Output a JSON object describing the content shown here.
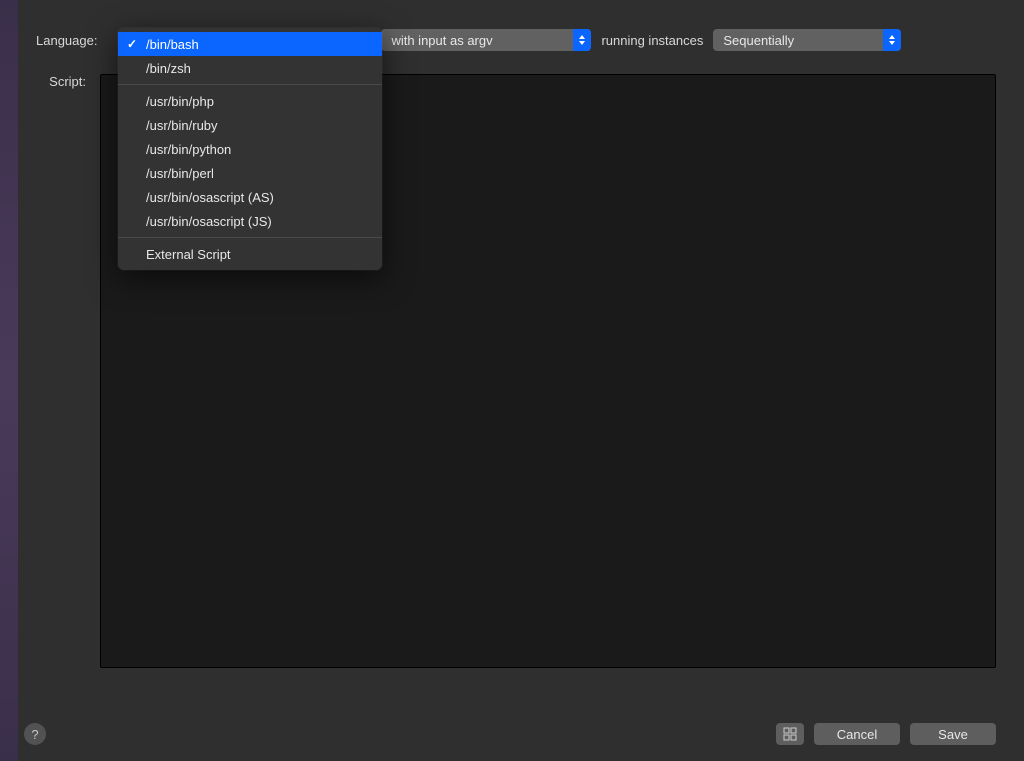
{
  "labels": {
    "language": "Language:",
    "script": "Script:",
    "running_instances": "running instances"
  },
  "selects": {
    "input": "with input as argv",
    "instances": "Sequentially"
  },
  "dropdown": {
    "group1": [
      {
        "label": "/bin/bash",
        "selected": true
      },
      {
        "label": "/bin/zsh",
        "selected": false
      }
    ],
    "group2": [
      {
        "label": "/usr/bin/php"
      },
      {
        "label": "/usr/bin/ruby"
      },
      {
        "label": "/usr/bin/python"
      },
      {
        "label": "/usr/bin/perl"
      },
      {
        "label": "/usr/bin/osascript (AS)"
      },
      {
        "label": "/usr/bin/osascript (JS)"
      }
    ],
    "group3": [
      {
        "label": "External Script"
      }
    ]
  },
  "buttons": {
    "help": "?",
    "cancel": "Cancel",
    "save": "Save"
  }
}
